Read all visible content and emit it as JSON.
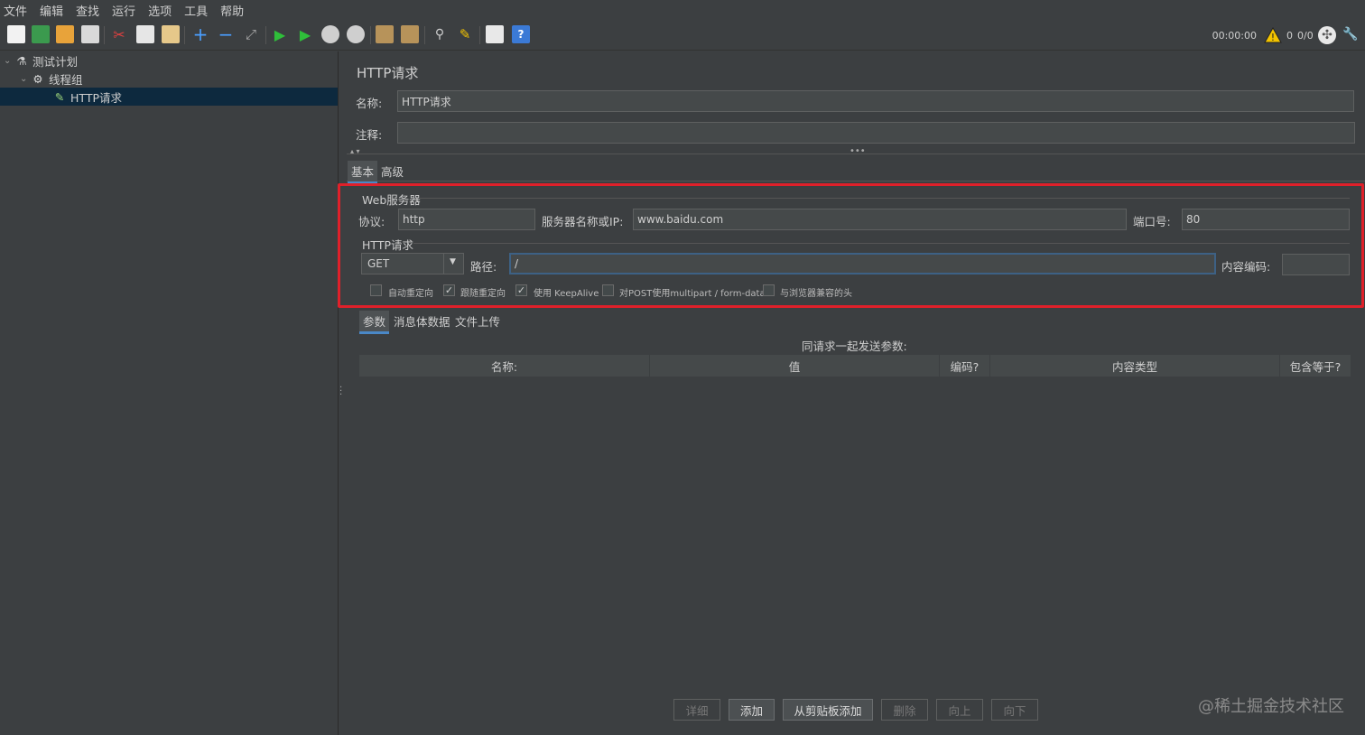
{
  "menu": [
    "文件",
    "编辑",
    "查找",
    "运行",
    "选项",
    "工具",
    "帮助"
  ],
  "toolbar": {
    "timer": "00:00:00",
    "warnings": "0",
    "threads": "0/0"
  },
  "tree": {
    "items": [
      {
        "label": "测试计划"
      },
      {
        "label": "线程组"
      },
      {
        "label": "HTTP请求"
      }
    ]
  },
  "sampler": {
    "title": "HTTP请求",
    "name_label": "名称:",
    "name_value": "HTTP请求",
    "comment_label": "注释:",
    "comment_value": "",
    "tabs": [
      "基本",
      "高级"
    ],
    "web_server_section": "Web服务器",
    "protocol_label": "协议:",
    "protocol_value": "http",
    "server_label": "服务器名称或IP:",
    "server_value": "www.baidu.com",
    "port_label": "端口号:",
    "port_value": "80",
    "http_section": "HTTP请求",
    "method_value": "GET",
    "path_label": "路径:",
    "path_value": "/",
    "encoding_label": "内容编码:",
    "encoding_value": "",
    "options": [
      {
        "label": "自动重定向",
        "checked": false
      },
      {
        "label": "跟随重定向",
        "checked": true
      },
      {
        "label": "使用 KeepAlive",
        "checked": true
      },
      {
        "label": "对POST使用multipart / form-data",
        "checked": false
      },
      {
        "label": "与浏览器兼容的头",
        "checked": false
      }
    ],
    "param_tabs": [
      "参数",
      "消息体数据",
      "文件上传"
    ],
    "params_caption": "同请求一起发送参数:",
    "columns": [
      "名称:",
      "值",
      "编码?",
      "内容类型",
      "包含等于?"
    ],
    "buttons": [
      "详细",
      "添加",
      "从剪贴板添加",
      "删除",
      "向上",
      "向下"
    ]
  },
  "watermark": "@稀土掘金技术社区"
}
